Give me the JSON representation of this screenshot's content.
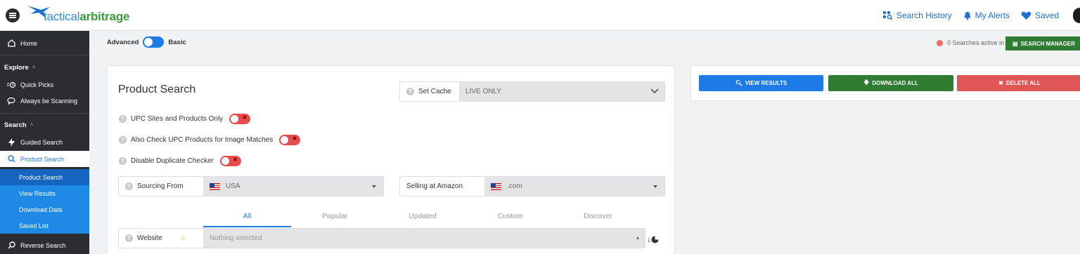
{
  "header": {
    "logo_light": "tactical",
    "logo_bold": "arbitrage",
    "links": [
      {
        "label": "Search History",
        "icon": "search-history-icon"
      },
      {
        "label": "My Alerts",
        "icon": "bell-icon"
      },
      {
        "label": "Saved",
        "icon": "heart-icon"
      }
    ]
  },
  "sidebar": {
    "home": "Home",
    "explore": "Explore",
    "quick_picks": "Quick Picks",
    "always_scanning": "Always be Scanning",
    "search": "Search",
    "guided_search": "Guided Search",
    "product_search": "Product Search",
    "sub": [
      "Product Search",
      "View Results",
      "Download Data",
      "Saved List"
    ],
    "reverse_search": "Reverse Search"
  },
  "mode": {
    "left": "Advanced",
    "right": "Basic"
  },
  "status": {
    "searches_text": "0 Searches active in",
    "manager_label": "SEARCH MANAGER"
  },
  "product_search": {
    "title": "Product Search",
    "set_cache_label": "Set Cache",
    "set_cache_value": "LIVE ONLY",
    "options": [
      "UPC Sites and Products Only",
      "Also Check UPC Products for Image Matches",
      "Disable Duplicate Checker"
    ],
    "sourcing_label": "Sourcing From",
    "sourcing_value": "USA",
    "selling_label": "Selling at Amazon",
    "selling_value": ".com",
    "tabs": [
      "All",
      "Popular",
      "Updated",
      "Custom",
      "Discover"
    ],
    "website_label": "Website",
    "website_placeholder": "Nothing selected"
  },
  "actions": {
    "view": "VIEW RESULTS",
    "download": "DOWNLOAD ALL",
    "delete": "DELETE ALL"
  },
  "colors": {
    "accent": "#1e7ae6",
    "green": "#2e7d32",
    "red": "#e05555"
  }
}
